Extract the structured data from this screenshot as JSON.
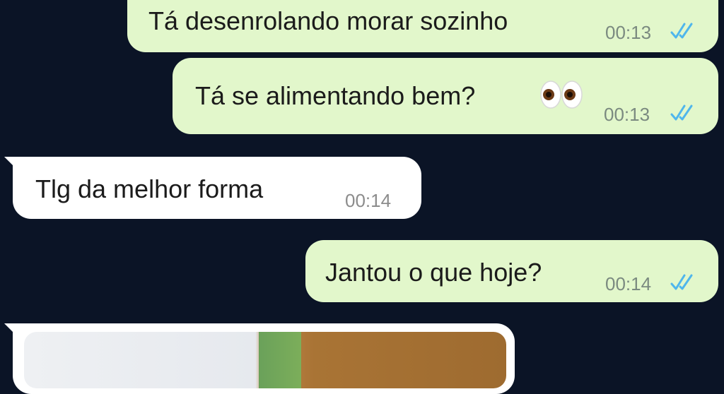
{
  "messages": [
    {
      "direction": "outgoing",
      "text": "Tá desenrolando morar sozinho",
      "time": "00:13",
      "status_icon": "double-check-read-icon"
    },
    {
      "direction": "outgoing",
      "text": "Tá se alimentando bem?",
      "emoji": "eyes-emoji",
      "time": "00:13",
      "status_icon": "double-check-read-icon"
    },
    {
      "direction": "incoming",
      "text": "Tlg da melhor forma",
      "time": "00:14"
    },
    {
      "direction": "outgoing",
      "text": "Jantou o que hoje?",
      "time": "00:14",
      "status_icon": "double-check-read-icon"
    },
    {
      "direction": "incoming",
      "type": "image"
    }
  ],
  "colors": {
    "background": "#0b1426",
    "outgoing_bubble": "#e2f7cb",
    "incoming_bubble": "#ffffff",
    "read_tick": "#4fb6ec"
  }
}
